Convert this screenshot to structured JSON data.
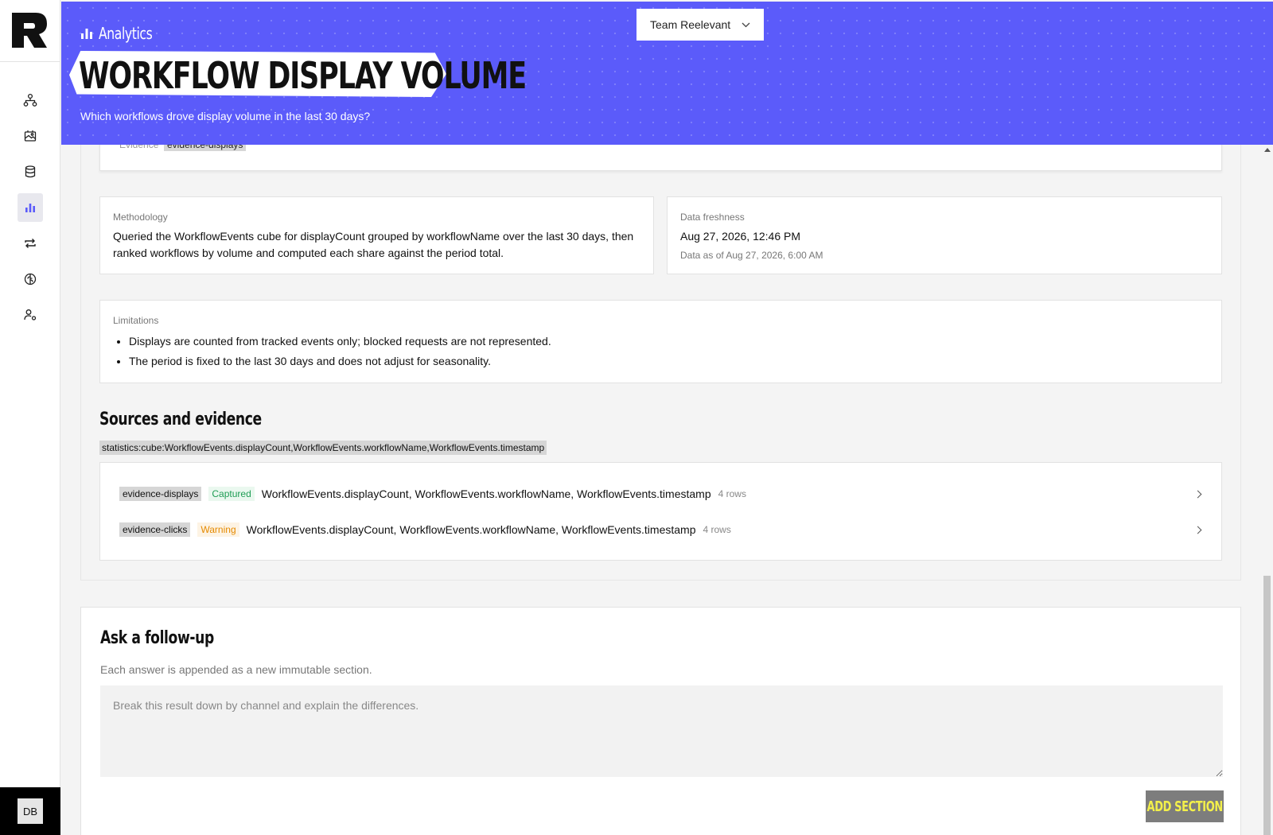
{
  "sidebar": {
    "nav": [
      {
        "icon": "workflow-icon"
      },
      {
        "icon": "image-template-icon"
      },
      {
        "icon": "database-icon"
      },
      {
        "icon": "analytics-icon",
        "active": true
      },
      {
        "icon": "sync-icon"
      },
      {
        "icon": "brain-icon"
      },
      {
        "icon": "user-settings-icon"
      }
    ],
    "user_initials": "DB"
  },
  "header": {
    "breadcrumb": "Analytics",
    "title": "WORKFLOW DISPLAY VOLUME",
    "subtitle": "Which workflows drove display volume in the last 30 days?",
    "team": "Team Reelevant",
    "accent": "#5b5bfa"
  },
  "evidence": {
    "label": "Evidence",
    "chip": "evidence-displays"
  },
  "methodology": {
    "label": "Methodology",
    "text": "Queried the WorkflowEvents cube for displayCount grouped by workflowName over the last 30 days, then ranked workflows by volume and computed each share against the period total."
  },
  "freshness": {
    "label": "Data freshness",
    "value": "Aug 27, 2026, 12:46 PM",
    "sub": "Data as of Aug 27, 2026, 6:00 AM"
  },
  "limitations": {
    "label": "Limitations",
    "items": [
      "Displays are counted from tracked events only; blocked requests are not represented.",
      "The period is fixed to the last 30 days and does not adjust for seasonality."
    ]
  },
  "sources": {
    "heading": "Sources and evidence",
    "source_chip": "statistics:cube:WorkflowEvents.displayCount,WorkflowEvents.workflowName,WorkflowEvents.timestamp",
    "rows": [
      {
        "id": "evidence-displays",
        "status": "Captured",
        "fields": "WorkflowEvents.displayCount, WorkflowEvents.workflowName, WorkflowEvents.timestamp",
        "rows": "4 rows"
      },
      {
        "id": "evidence-clicks",
        "status": "Warning",
        "fields": "WorkflowEvents.displayCount, WorkflowEvents.workflowName, WorkflowEvents.timestamp",
        "rows": "4 rows"
      }
    ],
    "status_colors": {
      "captured": "#1f9d55",
      "warning": "#e58a00"
    }
  },
  "followup": {
    "heading": "Ask a follow-up",
    "description": "Each answer is appended as a new immutable section.",
    "placeholder": "Break this result down by channel and explain the differences.",
    "button": "ADD SECTION",
    "button_text_color": "#f3f04a"
  }
}
